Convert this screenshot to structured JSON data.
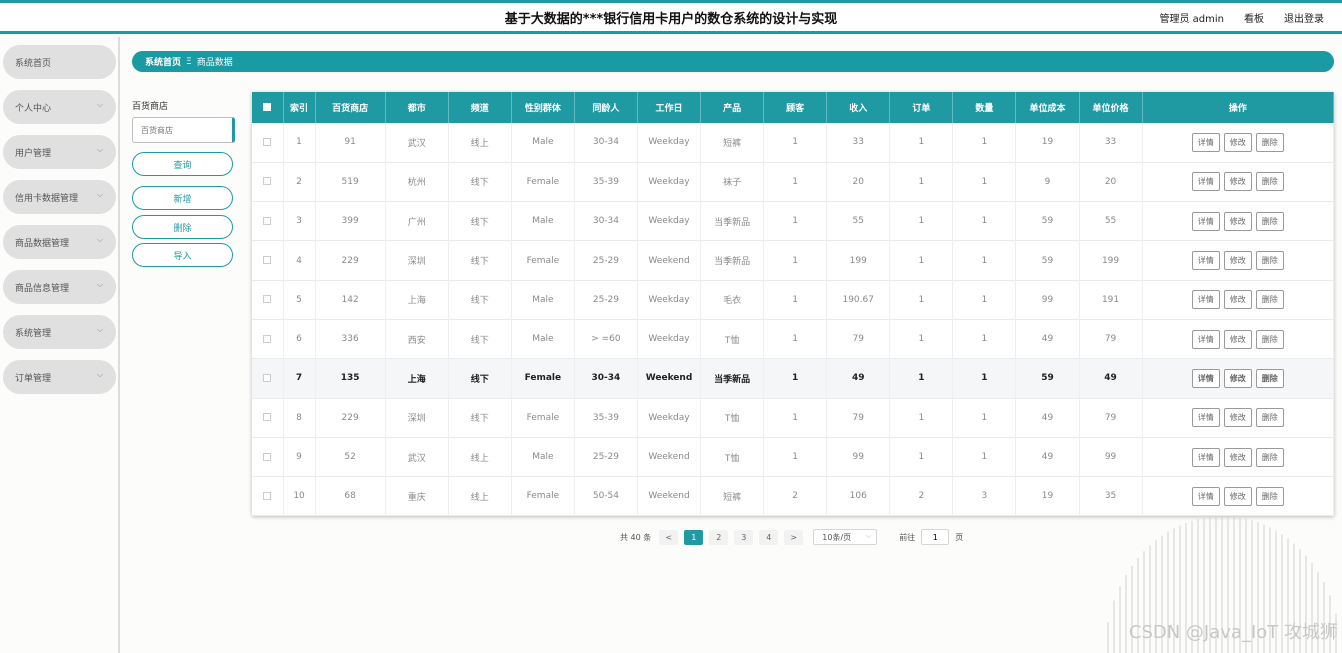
{
  "header": {
    "title": "基于大数据的***银行信用卡用户的数仓系统的设计与实现",
    "user_label": "管理员 admin",
    "board_label": "看板",
    "logout_label": "退出登录"
  },
  "sidebar": {
    "items": [
      {
        "label": "系统首页",
        "has_chevron": false
      },
      {
        "label": "个人中心",
        "has_chevron": true
      },
      {
        "label": "用户管理",
        "has_chevron": true
      },
      {
        "label": "信用卡数据管理",
        "has_chevron": true
      },
      {
        "label": "商品数据管理",
        "has_chevron": true
      },
      {
        "label": "商品信息管理",
        "has_chevron": true
      },
      {
        "label": "系统管理",
        "has_chevron": true
      },
      {
        "label": "订单管理",
        "has_chevron": true
      }
    ]
  },
  "breadcrumb": {
    "home": "系统首页",
    "separator": "Ξ",
    "current": "商品数据"
  },
  "filter": {
    "label": "百货商店",
    "placeholder": "百货商店",
    "query_btn": "查询",
    "add_btn": "新增",
    "delete_btn": "删除",
    "import_btn": "导入"
  },
  "table": {
    "columns": [
      "索引",
      "百货商店",
      "都市",
      "频道",
      "性别群体",
      "同龄人",
      "工作日",
      "产品",
      "顾客",
      "收入",
      "订单",
      "数量",
      "单位成本",
      "单位价格",
      "操作"
    ],
    "actions": [
      "详情",
      "修改",
      "删除"
    ],
    "rows": [
      [
        "1",
        "91",
        "武汉",
        "线上",
        "Male",
        "30-34",
        "Weekday",
        "短裤",
        "1",
        "33",
        "1",
        "1",
        "19",
        "33"
      ],
      [
        "2",
        "519",
        "杭州",
        "线下",
        "Female",
        "35-39",
        "Weekday",
        "袜子",
        "1",
        "20",
        "1",
        "1",
        "9",
        "20"
      ],
      [
        "3",
        "399",
        "广州",
        "线下",
        "Male",
        "30-34",
        "Weekday",
        "当季新品",
        "1",
        "55",
        "1",
        "1",
        "59",
        "55"
      ],
      [
        "4",
        "229",
        "深圳",
        "线下",
        "Female",
        "25-29",
        "Weekend",
        "当季新品",
        "1",
        "199",
        "1",
        "1",
        "59",
        "199"
      ],
      [
        "5",
        "142",
        "上海",
        "线下",
        "Male",
        "25-29",
        "Weekday",
        "毛衣",
        "1",
        "190.67",
        "1",
        "1",
        "99",
        "191"
      ],
      [
        "6",
        "336",
        "西安",
        "线下",
        "Male",
        "> =60",
        "Weekday",
        "T恤",
        "1",
        "79",
        "1",
        "1",
        "49",
        "79"
      ],
      [
        "7",
        "135",
        "上海",
        "线下",
        "Female",
        "30-34",
        "Weekend",
        "当季新品",
        "1",
        "49",
        "1",
        "1",
        "59",
        "49"
      ],
      [
        "8",
        "229",
        "深圳",
        "线下",
        "Female",
        "35-39",
        "Weekday",
        "T恤",
        "1",
        "79",
        "1",
        "1",
        "49",
        "79"
      ],
      [
        "9",
        "52",
        "武汉",
        "线上",
        "Male",
        "25-29",
        "Weekend",
        "T恤",
        "1",
        "99",
        "1",
        "1",
        "49",
        "99"
      ],
      [
        "10",
        "68",
        "重庆",
        "线上",
        "Female",
        "50-54",
        "Weekend",
        "短裤",
        "2",
        "106",
        "2",
        "3",
        "19",
        "35"
      ]
    ],
    "highlighted_row": 6
  },
  "pagination": {
    "total_text": "共 40 条",
    "prev": "<",
    "next": ">",
    "pages": [
      "1",
      "2",
      "3",
      "4"
    ],
    "active_page": "1",
    "page_size": "10条/页",
    "goto_label": "前往",
    "goto_value": "1",
    "page_suffix": "页"
  },
  "watermark": "CSDN @Java_IoT 攻城狮",
  "colors": {
    "accent": "#1f9aa3",
    "sidebar_item": "#e0e0e0"
  }
}
